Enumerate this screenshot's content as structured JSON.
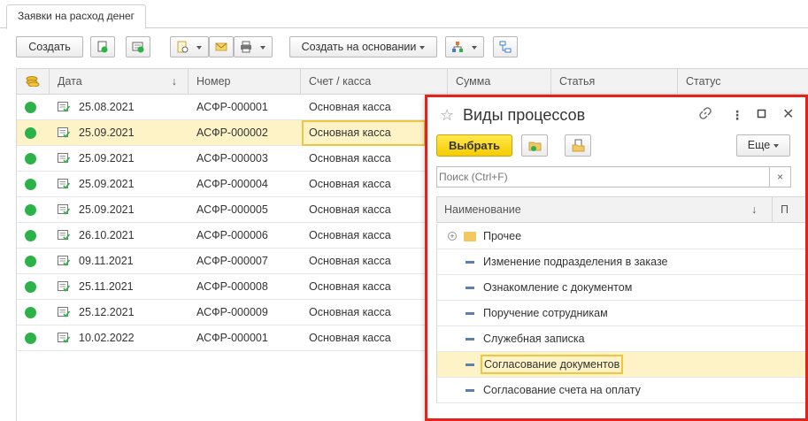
{
  "tab": {
    "label": "Заявки на расход денег"
  },
  "toolbar": {
    "create_label": "Создать",
    "create_based_label": "Создать на основании"
  },
  "grid": {
    "columns": [
      "Дата",
      "Номер",
      "Счет / касса",
      "Сумма",
      "Статья",
      "Статус"
    ],
    "sort_arrow": "↓",
    "rows": [
      {
        "date": "25.08.2021",
        "number": "АСФР-000001",
        "account": "Основная касса"
      },
      {
        "date": "25.09.2021",
        "number": "АСФР-000002",
        "account": "Основная касса"
      },
      {
        "date": "25.09.2021",
        "number": "АСФР-000003",
        "account": "Основная касса"
      },
      {
        "date": "25.09.2021",
        "number": "АСФР-000004",
        "account": "Основная касса"
      },
      {
        "date": "25.09.2021",
        "number": "АСФР-000005",
        "account": "Основная касса"
      },
      {
        "date": "26.10.2021",
        "number": "АСФР-000006",
        "account": "Основная касса"
      },
      {
        "date": "09.11.2021",
        "number": "АСФР-000007",
        "account": "Основная касса"
      },
      {
        "date": "25.11.2021",
        "number": "АСФР-000008",
        "account": "Основная касса"
      },
      {
        "date": "25.12.2021",
        "number": "АСФР-000009",
        "account": "Основная касса"
      },
      {
        "date": "10.02.2022",
        "number": "АСФР-000001",
        "account": "Основная касса"
      }
    ]
  },
  "dialog": {
    "title": "Виды процессов",
    "select_label": "Выбрать",
    "more_label": "Еще",
    "search_placeholder": "Поиск (Ctrl+F)",
    "clear_label": "×",
    "col_name": "Наименование",
    "col_sort": "↓",
    "col_p": "П",
    "items": [
      {
        "label": "Прочее"
      },
      {
        "label": "Изменение подразделения в заказе"
      },
      {
        "label": "Ознакомление с документом"
      },
      {
        "label": "Поручение сотрудникам"
      },
      {
        "label": "Служебная записка"
      },
      {
        "label": "Согласование документов"
      },
      {
        "label": "Согласование счета на оплату"
      }
    ]
  },
  "colors": {
    "accent_yellow": "#f5cc00",
    "selection": "#fdf3c7",
    "highlight_border": "#e2231a",
    "status_green": "#2db24a"
  }
}
